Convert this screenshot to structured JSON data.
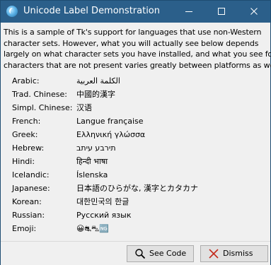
{
  "window": {
    "title": "Unicode Label Demonstration"
  },
  "intro_lines": [
    "This is a sample of Tk's support for languages that use non-Western",
    "character sets.  However, what you will actually see below depends",
    "largely on what character sets you have installed, and what you see for",
    "characters that are not present varies greatly between platforms as well."
  ],
  "languages": [
    {
      "label": "Arabic:",
      "sample": "الكلمة العربية"
    },
    {
      "label": "Trad. Chinese:",
      "sample": "中國的漢字"
    },
    {
      "label": "Simpl. Chinese:",
      "sample": "汉语"
    },
    {
      "label": "French:",
      "sample": "Langue française"
    },
    {
      "label": "Greek:",
      "sample": "Ελληνική γλώσσα"
    },
    {
      "label": "Hebrew:",
      "sample": "תירבע עיתב"
    },
    {
      "label": "Hindi:",
      "sample": "हिन्दी भाषा"
    },
    {
      "label": "Icelandic:",
      "sample": "Íslenska"
    },
    {
      "label": "Japanese:",
      "sample": "日本語のひらがな, 漢字とカタカナ"
    },
    {
      "label": "Korean:",
      "sample": "대한민국의 한글"
    },
    {
      "label": "Russian:",
      "sample": "Русский язык"
    },
    {
      "label": "Emoji:",
      "sample": "😀⛐⛍🆖"
    }
  ],
  "buttons": {
    "see_code": "See Code",
    "dismiss": "Dismiss"
  },
  "colors": {
    "titlebar": "#2b5f8a",
    "dialog_bg": "#f0f0f0",
    "dismiss_icon": "#c42b1c"
  },
  "icons": {
    "app": "tk-feather-icon",
    "minimize": "minimize-icon",
    "maximize": "maximize-icon",
    "close": "close-icon",
    "see_code": "magnifier-icon",
    "dismiss": "red-x-icon"
  }
}
